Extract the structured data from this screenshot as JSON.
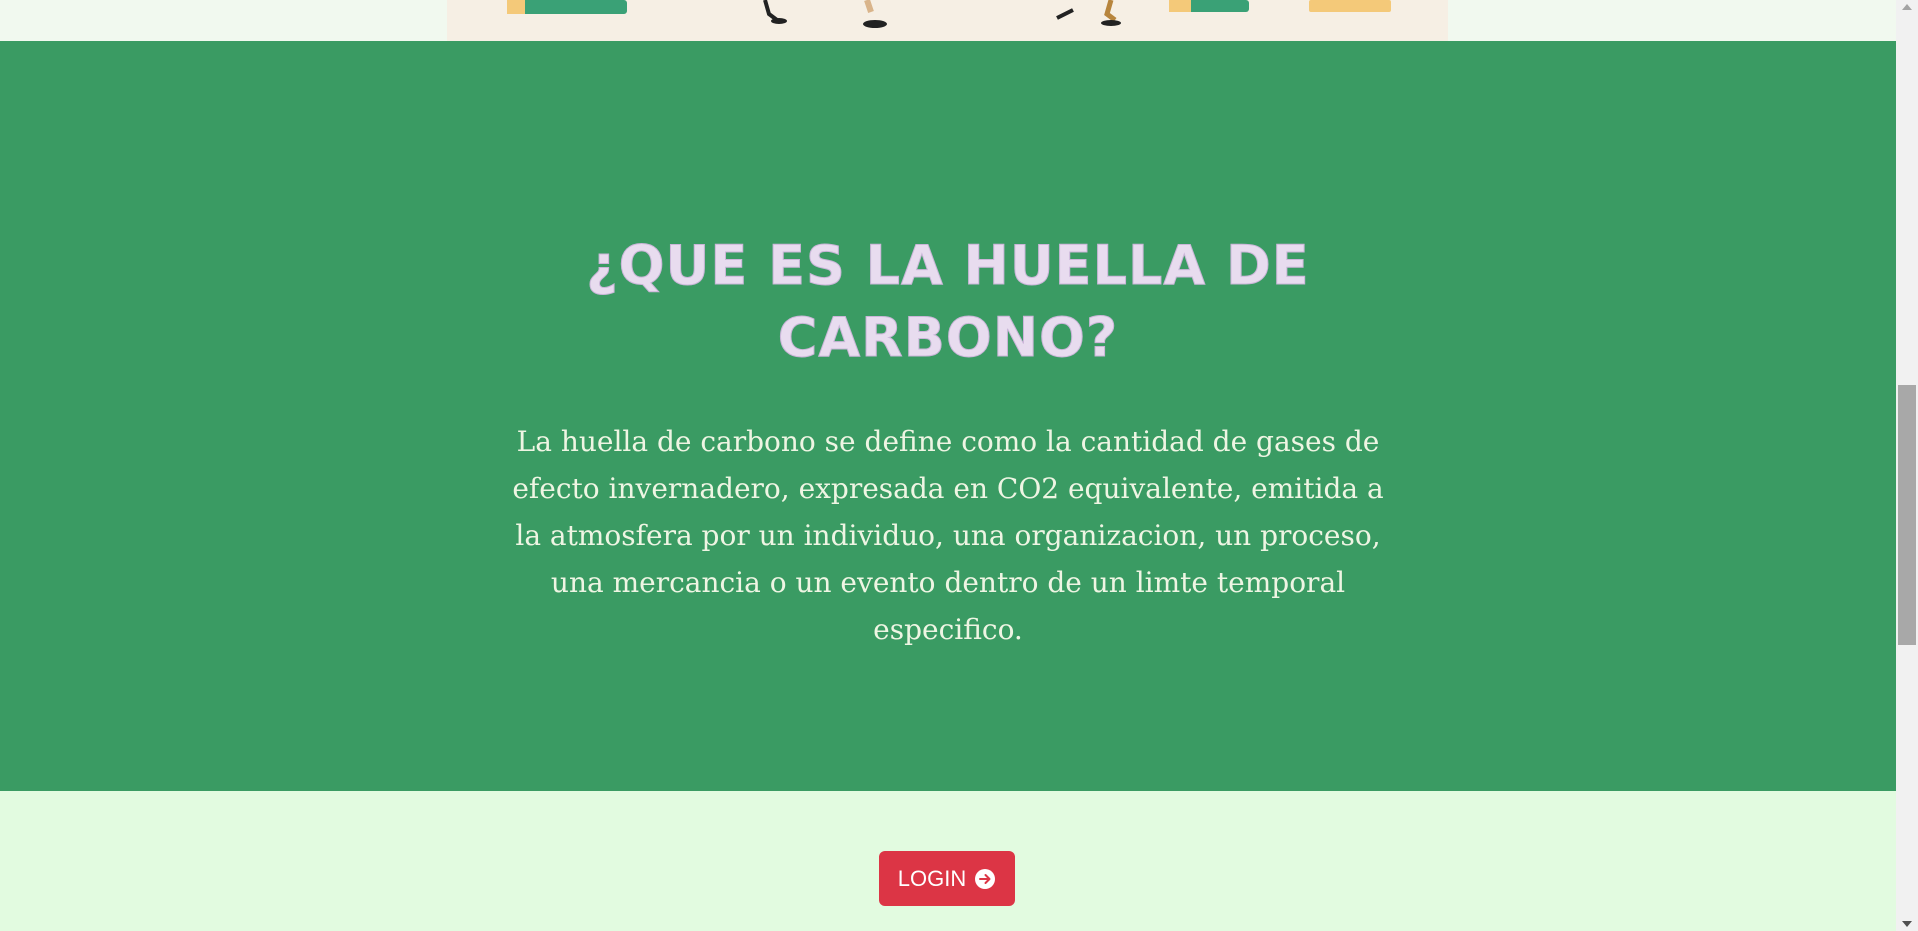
{
  "hero": {
    "illustration_icon": "people-moving-boxes-illustration"
  },
  "section": {
    "title": "¿QUE ES LA HUELLA DE CARBONO?",
    "description": "La huella de carbono se define como la cantidad de gases de efecto invernadero, expresada en CO2 equivalente, emitida a la atmosfera por un individuo, una organizacion, un proceso, una mercancia o un evento dentro de un limte temporal especifico."
  },
  "actions": {
    "login_label": "LOGIN",
    "login_icon": "arrow-right-circle-icon"
  },
  "colors": {
    "section_background": "#3a9b63",
    "title_color": "#e8dcef",
    "description_color": "#eef5e3",
    "page_background": "#e2fbe0",
    "button_background": "#dc3545"
  }
}
